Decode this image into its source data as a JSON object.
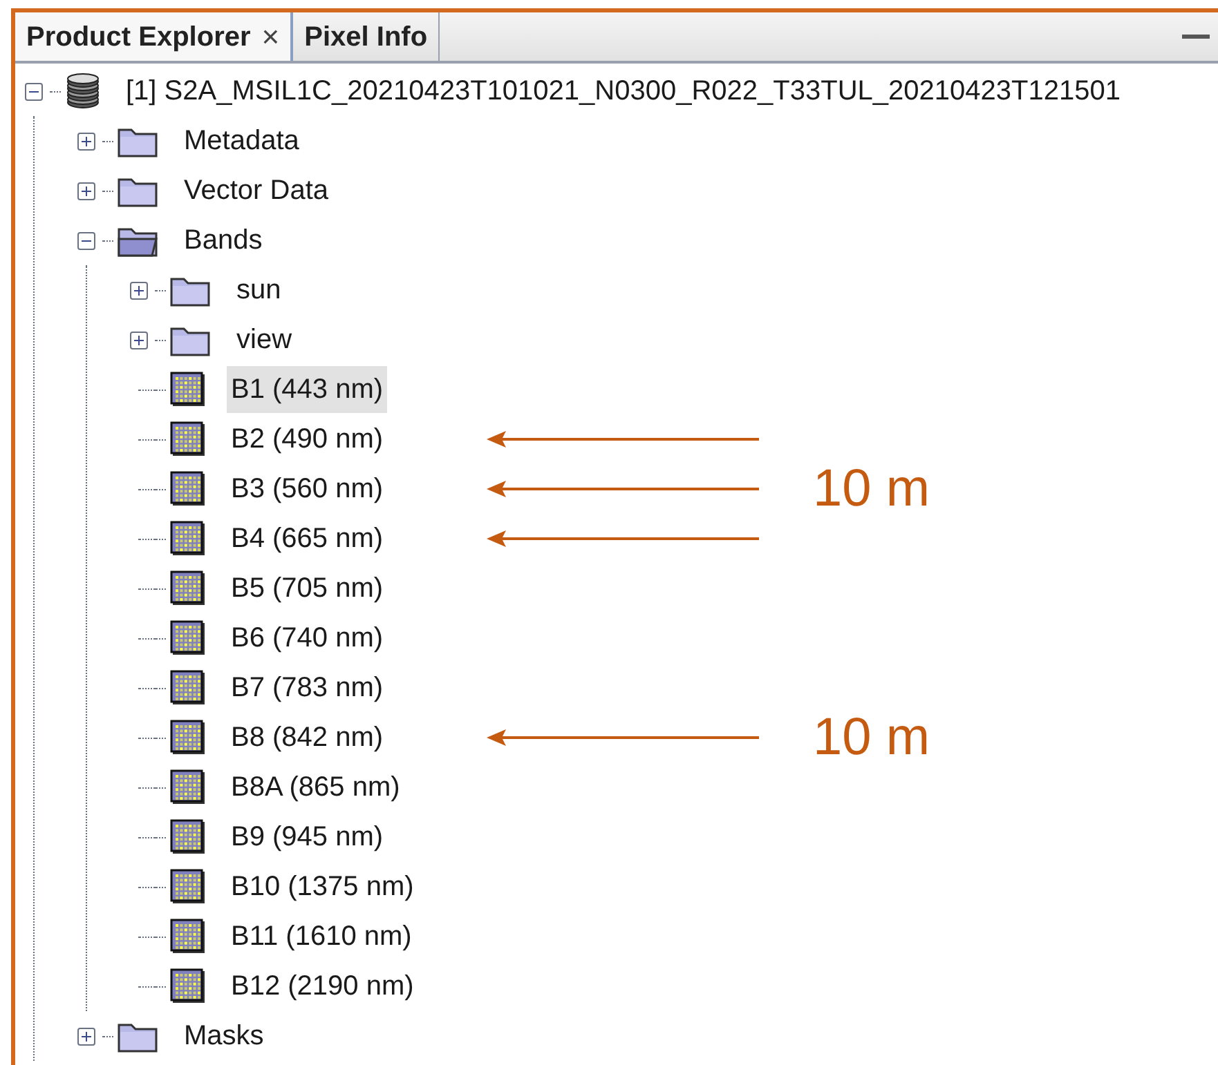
{
  "tabs": [
    {
      "label": "Product Explorer",
      "selected": true,
      "close": "×"
    },
    {
      "label": "Pixel Info",
      "selected": false
    }
  ],
  "tree": [
    {
      "kind": "product",
      "label": "[1] S2A_MSIL1C_20210423T101021_N0300_R022_T33TUL_20210423T121501",
      "expanded": true,
      "selected": false,
      "children": [
        {
          "kind": "folder",
          "label": "Metadata",
          "expanded": false,
          "selected": false
        },
        {
          "kind": "folder",
          "label": "Vector Data",
          "expanded": false,
          "selected": false
        },
        {
          "kind": "folder",
          "label": "Bands",
          "expanded": true,
          "selected": false,
          "children": [
            {
              "kind": "folder",
              "label": "sun",
              "expanded": false,
              "selected": false
            },
            {
              "kind": "folder",
              "label": "view",
              "expanded": false,
              "selected": false
            },
            {
              "kind": "band",
              "label": "B1 (443 nm)",
              "selected": true
            },
            {
              "kind": "band",
              "label": "B2 (490 nm)",
              "selected": false,
              "arrow": true
            },
            {
              "kind": "band",
              "label": "B3 (560 nm)",
              "selected": false,
              "arrow": true,
              "note": "10 m"
            },
            {
              "kind": "band",
              "label": "B4 (665 nm)",
              "selected": false,
              "arrow": true
            },
            {
              "kind": "band",
              "label": "B5 (705 nm)",
              "selected": false
            },
            {
              "kind": "band",
              "label": "B6 (740 nm)",
              "selected": false
            },
            {
              "kind": "band",
              "label": "B7 (783 nm)",
              "selected": false
            },
            {
              "kind": "band",
              "label": "B8 (842 nm)",
              "selected": false,
              "arrow": true,
              "note": "10 m"
            },
            {
              "kind": "band",
              "label": "B8A (865 nm)",
              "selected": false
            },
            {
              "kind": "band",
              "label": "B9 (945 nm)",
              "selected": false
            },
            {
              "kind": "band",
              "label": "B10 (1375 nm)",
              "selected": false
            },
            {
              "kind": "band",
              "label": "B11 (1610 nm)",
              "selected": false
            },
            {
              "kind": "band",
              "label": "B12 (2190 nm)",
              "selected": false
            }
          ]
        },
        {
          "kind": "folder",
          "label": "Masks",
          "expanded": false,
          "selected": false
        }
      ]
    }
  ]
}
